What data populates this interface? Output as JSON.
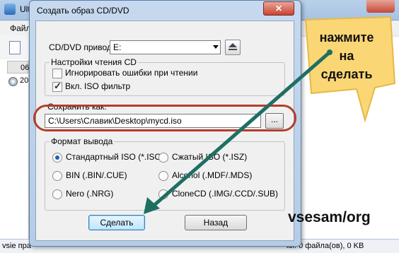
{
  "background_app": {
    "title": "Ult",
    "menu_label": "Файл",
    "side_header": "06",
    "side_row": "20",
    "status_left": "vsie пра",
    "status_right": "ки: 0 файла(ов), 0 KB"
  },
  "dialog": {
    "title": "Создать образ CD/DVD",
    "close_glyph": "✕",
    "drive_label": "CD/DVD привод:",
    "drive_value": "E:",
    "read_settings": {
      "legend": "Настройки чтения CD",
      "ignore_errors_label": "Игнорировать ошибки при чтении",
      "ignore_errors_checked": false,
      "iso_filter_label": "Вкл. ISO фильтр",
      "iso_filter_checked": true
    },
    "save_as_label": "Сохранить как:",
    "save_path": "C:\\Users\\Славик\\Desktop\\mycd.iso",
    "browse_label": "...",
    "output_format": {
      "legend": "Формат вывода",
      "options": [
        {
          "label": "Стандартный ISO (*.ISO)",
          "selected": true
        },
        {
          "label": "Сжатый ISO (*.ISZ)",
          "selected": false
        },
        {
          "label": "BIN (.BIN/.CUE)",
          "selected": false
        },
        {
          "label": "Alcohol (.MDF/.MDS)",
          "selected": false
        },
        {
          "label": "Nero (.NRG)",
          "selected": false
        },
        {
          "label": "CloneCD (.IMG/.CCD/.SUB)",
          "selected": false
        }
      ]
    },
    "make_button": "Сделать",
    "back_button": "Назад"
  },
  "annotation": {
    "callout_line1": "нажмите",
    "callout_line2": "на",
    "callout_line3": "сделать",
    "watermark": "vsesam/org",
    "callout_color": "#fbd675",
    "arrow_color": "#1e6f62",
    "oval_color": "#b63c2a"
  },
  "icons": [
    "dropdown-arrow-icon",
    "eject-icon",
    "checkmark-icon",
    "disc-icon",
    "app-icon",
    "document-icon"
  ]
}
